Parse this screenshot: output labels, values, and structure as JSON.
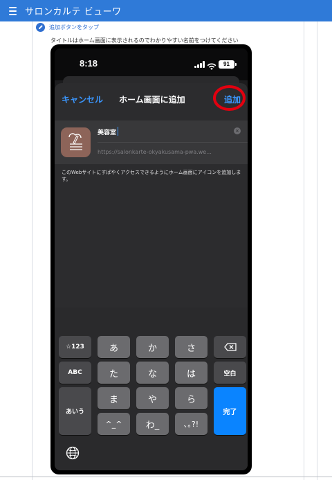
{
  "app": {
    "title": "サロンカルテ ビューワ"
  },
  "step": {
    "label": "追加ボタンをタップ"
  },
  "caption": "タイトルはホーム画面に表示されるのでわかりやすい名前をつけてください",
  "phone": {
    "status": {
      "time": "8:18",
      "battery": "91"
    },
    "sheet": {
      "cancel": "キャンセル",
      "title": "ホーム画面に追加",
      "add": "追加",
      "name_value": "美容室",
      "url": "https://salonkarte-okyakusama-pwa.we...",
      "description": "このWebサイトにすばやくアクセスできるようにホーム画面にアイコンを追加します。"
    },
    "keyboard": {
      "row1": [
        "☆123",
        "あ",
        "か",
        "さ"
      ],
      "row2": [
        "ABC",
        "た",
        "な",
        "は",
        "空白"
      ],
      "row3": [
        "あいう",
        "ま",
        "や",
        "ら",
        "完了"
      ],
      "row4": [
        "^_^",
        "わ_",
        "､｡?!"
      ],
      "backspace_icon": "backspace-icon",
      "globe_icon": "globe-icon"
    }
  },
  "colors": {
    "appbar": "#2f7ad8",
    "link": "#3b97ff",
    "highlight": "#e3000f",
    "done_key": "#0a84ff"
  }
}
